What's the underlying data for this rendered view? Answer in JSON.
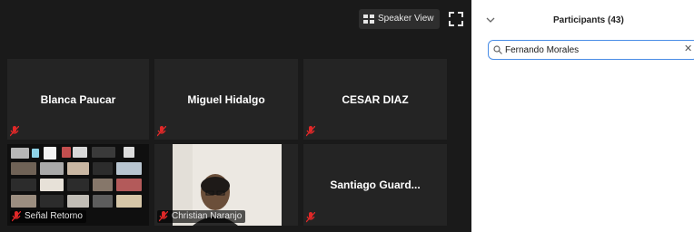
{
  "meeting": {
    "speaker_view_label": "Speaker View",
    "tiles": [
      {
        "name": "Blanca Paucar"
      },
      {
        "name": "Miguel Hidalgo"
      },
      {
        "name": "CESAR DIAZ"
      },
      {
        "name": "Señal Retorno"
      },
      {
        "name": "Christian Naranjo"
      },
      {
        "name": "Santiago  Guard..."
      }
    ]
  },
  "participants_panel": {
    "title": "Participants (43)",
    "search": {
      "value": "Fernando Morales"
    }
  },
  "colors": {
    "video_bg": "#1a1a1a",
    "tile_bg": "#242424",
    "mute_red": "#e02828",
    "search_focus": "#4a8de6"
  },
  "icons": [
    "grid-icon",
    "fullscreen-icon",
    "mic-muted-icon",
    "chevron-down-icon",
    "search-icon",
    "clear-icon"
  ]
}
